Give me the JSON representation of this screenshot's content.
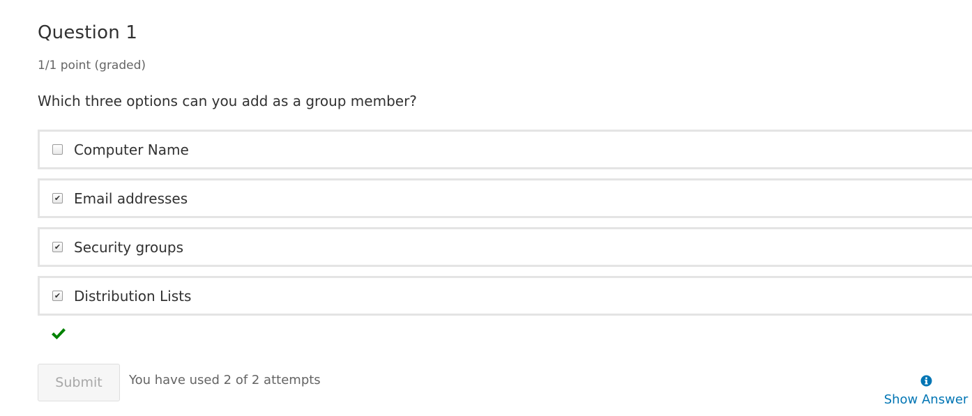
{
  "question": {
    "title": "Question 1",
    "points": "1/1 point (graded)",
    "prompt": "Which three options can you add as a group member?"
  },
  "options": [
    {
      "label": "Computer Name",
      "checked": false
    },
    {
      "label": "Email addresses",
      "checked": true
    },
    {
      "label": "Security groups",
      "checked": true
    },
    {
      "label": "Distribution Lists",
      "checked": true
    }
  ],
  "status": {
    "icon": "checkmark-icon",
    "color": "#008100",
    "result": "correct"
  },
  "actions": {
    "submit_label": "Submit",
    "attempts_text": "You have used 2 of 2 attempts",
    "show_answer_label": "Show Answer",
    "show_answer_icon": "info-icon"
  },
  "colors": {
    "link": "#0075b4",
    "border": "#e4e4e4",
    "text": "#313131",
    "muted": "#646464"
  }
}
